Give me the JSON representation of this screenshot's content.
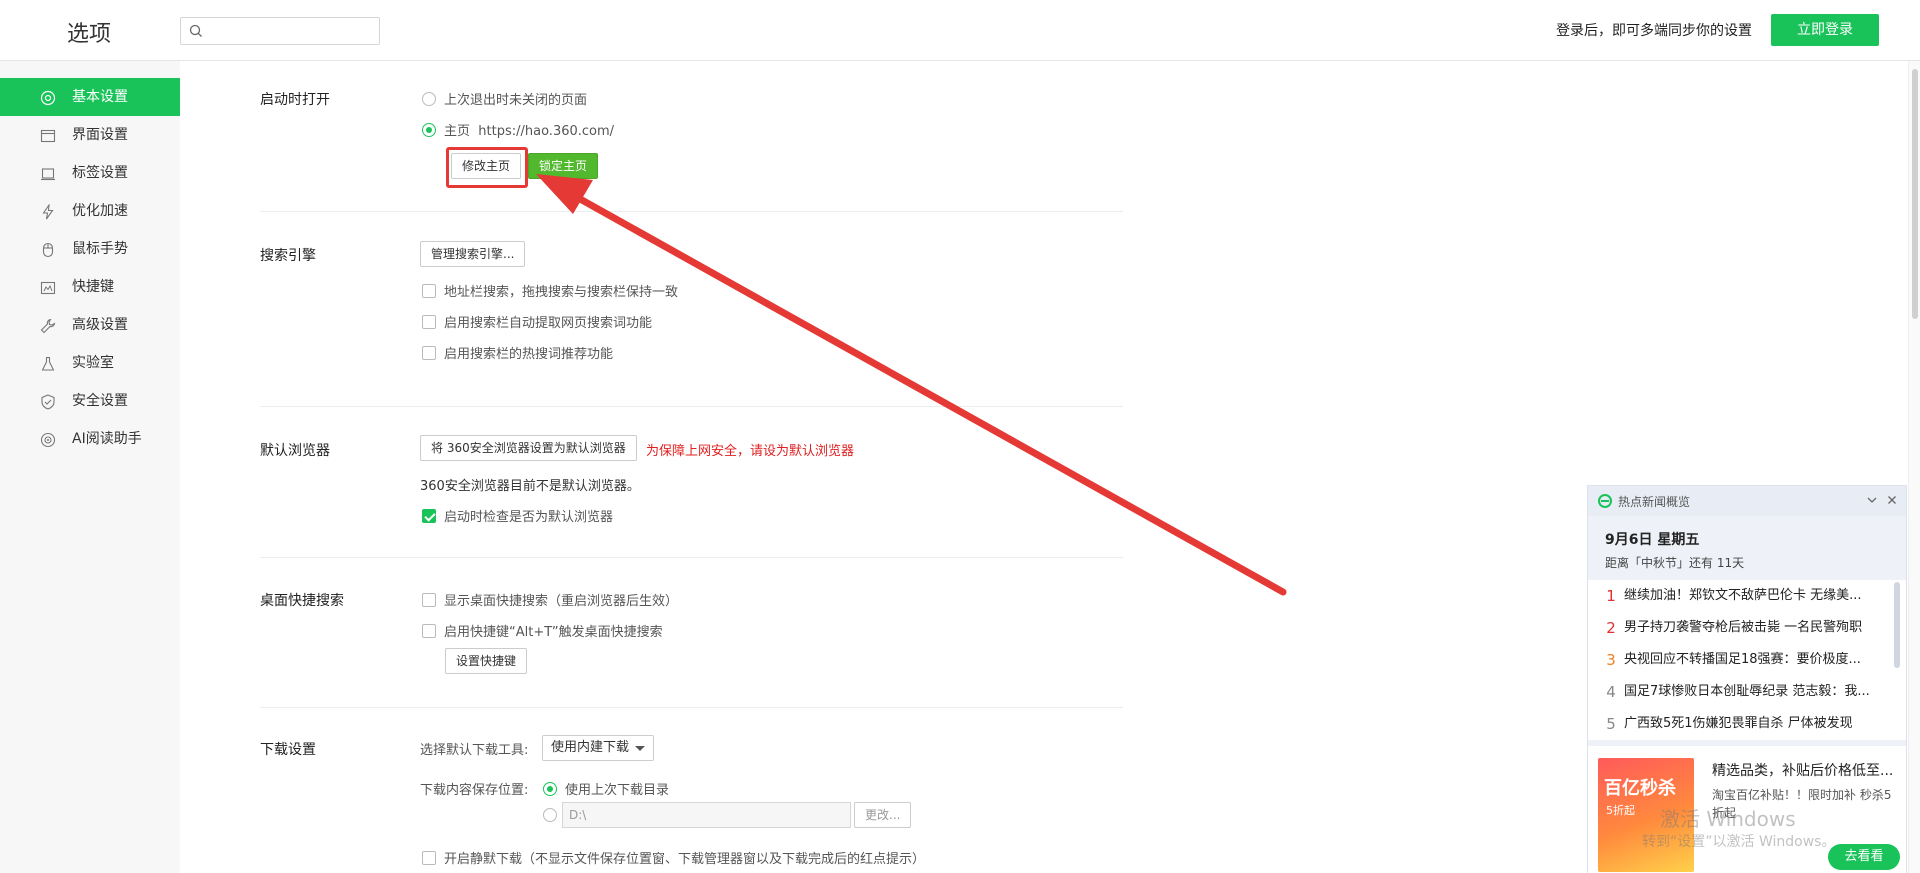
{
  "header": {
    "title": "选项",
    "search_placeholder": "",
    "sync_tip": "登录后，即可多端同步你的设置",
    "login_label": "立即登录"
  },
  "sidebar": {
    "items": [
      {
        "label": "基本设置",
        "icon": "gear-circle-icon",
        "active": true
      },
      {
        "label": "界面设置",
        "icon": "window-icon"
      },
      {
        "label": "标签设置",
        "icon": "tab-icon"
      },
      {
        "label": "优化加速",
        "icon": "lightning-icon"
      },
      {
        "label": "鼠标手势",
        "icon": "mouse-icon"
      },
      {
        "label": "快捷键",
        "icon": "keyboard-icon"
      },
      {
        "label": "高级设置",
        "icon": "wrench-icon"
      },
      {
        "label": "实验室",
        "icon": "flask-icon"
      },
      {
        "label": "安全设置",
        "icon": "shield-icon"
      },
      {
        "label": "AI阅读助手",
        "icon": "ai-icon"
      }
    ]
  },
  "startup": {
    "title": "启动时打开",
    "option_last": "上次退出时未关闭的页面",
    "option_home": "主页",
    "home_url": "https://hao.360.com/",
    "modify_label": "修改主页",
    "lock_label": "锁定主页"
  },
  "search_engine": {
    "title": "搜索引擎",
    "manage_label": "管理搜索引擎...",
    "opt1": "地址栏搜索，拖拽搜索与搜索栏保持一致",
    "opt2": "启用搜索栏自动提取网页搜索词功能",
    "opt3": "启用搜索栏的热搜词推荐功能"
  },
  "default_browser": {
    "title": "默认浏览器",
    "set_label": "将 360安全浏览器设置为默认浏览器",
    "warning": "为保障上网安全，请设为默认浏览器",
    "status": "360安全浏览器目前不是默认浏览器。",
    "check_label": "启动时检查是否为默认浏览器"
  },
  "desktop_search": {
    "title": "桌面快捷搜索",
    "opt1": "显示桌面快捷搜索（重启浏览器后生效）",
    "opt2": "启用快捷键“Alt+T”触发桌面快捷搜索",
    "shortcut_label": "设置快捷键"
  },
  "download": {
    "title": "下载设置",
    "tool_label": "选择默认下载工具:",
    "tool_value": "使用内建下载",
    "save_label": "下载内容保存位置:",
    "use_last": "使用上次下载目录",
    "path_value": "D:\\",
    "change_label": "更改...",
    "silent": "开启静默下载（不显示文件保存位置窗、下载管理器窗以及下载完成后的红点提示）"
  },
  "news": {
    "header": "热点新闻概览",
    "date": "9月6日 星期五",
    "countdown": "距离「中秋节」还有 11天",
    "items": [
      {
        "num": "1",
        "text": "继续加油！郑钦文不敌萨巴伦卡 无缘美..."
      },
      {
        "num": "2",
        "text": "男子持刀袭警夺枪后被击毙 一名民警殉职"
      },
      {
        "num": "3",
        "text": "央视回应不转播国足18强赛：要价极度..."
      },
      {
        "num": "4",
        "text": "国足7球惨败日本创耻辱纪录 范志毅：我..."
      },
      {
        "num": "5",
        "text": "广西致5死1伤嫌犯畏罪自杀 尸体被发现"
      }
    ],
    "num_colors": [
      "#e03030",
      "#e03030",
      "#f08020",
      "#888888",
      "#888888"
    ],
    "ad_img_title": "百亿秒杀",
    "ad_img_sub": "5折起",
    "ad_title": "精选品类，补贴后价格低至...",
    "ad_desc": "淘宝百亿补贴！！限时加补 秒杀5折起",
    "ad_button": "去看看"
  },
  "watermark": {
    "line1": "激活 Windows",
    "line2": "转到“设置”以激活 Windows。"
  },
  "colors": {
    "accent": "#19c35a",
    "warning": "#e02020",
    "annotation": "#e53935"
  }
}
